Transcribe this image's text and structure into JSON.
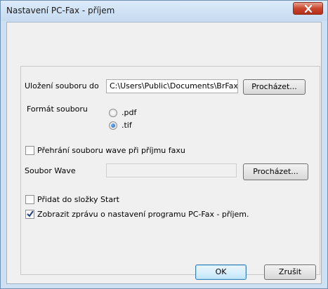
{
  "window": {
    "title": "Nastavení PC-Fax - příjem"
  },
  "file_location": {
    "label": "Uložení souboru do",
    "value": "C:\\Users\\Public\\Documents\\BrFaxF",
    "browse_label": "Procházet..."
  },
  "file_format": {
    "label": "Formát souboru",
    "options": [
      {
        "label": ".pdf",
        "selected": false
      },
      {
        "label": ".tif",
        "selected": true
      }
    ]
  },
  "wave_playback": {
    "label": "Přehrání souboru wave při příjmu faxu",
    "checked": false
  },
  "wave_file": {
    "label": "Soubor Wave",
    "value": "",
    "browse_label": "Procházet..."
  },
  "add_to_startup": {
    "label": "Přidat do složky Start",
    "checked": false
  },
  "show_message": {
    "label": "Zobrazit zprávu o nastavení programu PC-Fax - příjem.",
    "checked": true
  },
  "footer": {
    "ok_label": "OK",
    "cancel_label": "Zrušit"
  }
}
